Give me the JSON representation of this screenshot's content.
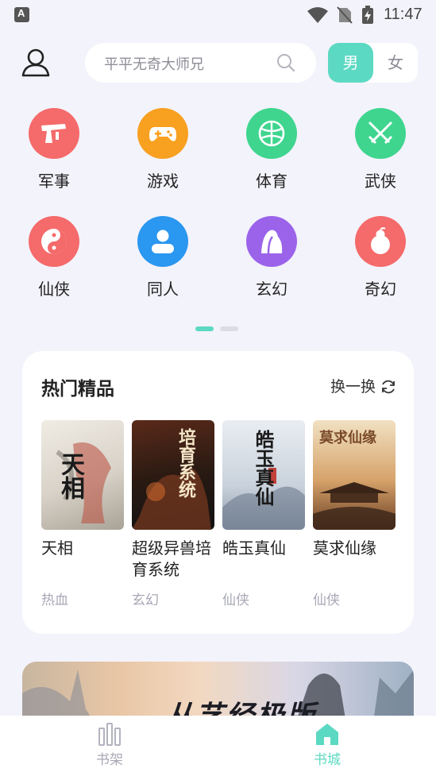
{
  "status_bar": {
    "time": "11:47"
  },
  "search": {
    "placeholder": "平平无奇大师兄"
  },
  "gender": {
    "male": "男",
    "female": "女"
  },
  "colors": {
    "accent": "#5cd9c2",
    "inactive": "#a8a8b6"
  },
  "categories": [
    {
      "label": "军事",
      "icon": "gun-icon",
      "color": "#f56a6a"
    },
    {
      "label": "游戏",
      "icon": "gamepad-icon",
      "color": "#f8a020"
    },
    {
      "label": "体育",
      "icon": "basketball-icon",
      "color": "#3fd58f"
    },
    {
      "label": "武侠",
      "icon": "crossed-swords-icon",
      "color": "#3fd58f"
    },
    {
      "label": "仙侠",
      "icon": "yin-yang-icon",
      "color": "#f56a6a"
    },
    {
      "label": "同人",
      "icon": "person-icon",
      "color": "#2a97f0"
    },
    {
      "label": "玄幻",
      "icon": "rock-icon",
      "color": "#9b63ea"
    },
    {
      "label": "奇幻",
      "icon": "gourd-icon",
      "color": "#f56a6a"
    }
  ],
  "hot": {
    "title": "热门精品",
    "refresh": "换一换",
    "books": [
      {
        "title": "天相",
        "tag": "热血",
        "cover_text": "天相"
      },
      {
        "title": "超级异兽培育系统",
        "tag": "玄幻",
        "cover_text": "培育系统"
      },
      {
        "title": "皓玉真仙",
        "tag": "仙侠",
        "cover_text": "皓玉真仙"
      },
      {
        "title": "莫求仙缘",
        "tag": "仙侠",
        "cover_text": "莫求仙缘"
      }
    ]
  },
  "banner": {
    "text": "从艺经极版"
  },
  "bottom_nav": {
    "shelf": "书架",
    "store": "书城"
  }
}
